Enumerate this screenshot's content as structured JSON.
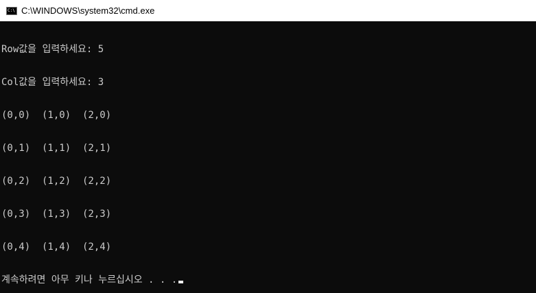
{
  "window": {
    "title": "C:\\WINDOWS\\system32\\cmd.exe",
    "icon": "cmd-icon",
    "icon_text": "C:\\",
    "colors": {
      "titlebar_bg": "#ffffff",
      "console_bg": "#0c0c0c",
      "console_fg": "#cccccc"
    }
  },
  "console": {
    "lines": [
      "Row값을 입력하세요: 5",
      "Col값을 입력하세요: 3",
      "(0,0)  (1,0)  (2,0)",
      "(0,1)  (1,1)  (2,1)",
      "(0,2)  (1,2)  (2,2)",
      "(0,3)  (1,3)  (2,3)",
      "(0,4)  (1,4)  (2,4)",
      "계속하려면 아무 키나 누르십시오 . . ."
    ]
  }
}
